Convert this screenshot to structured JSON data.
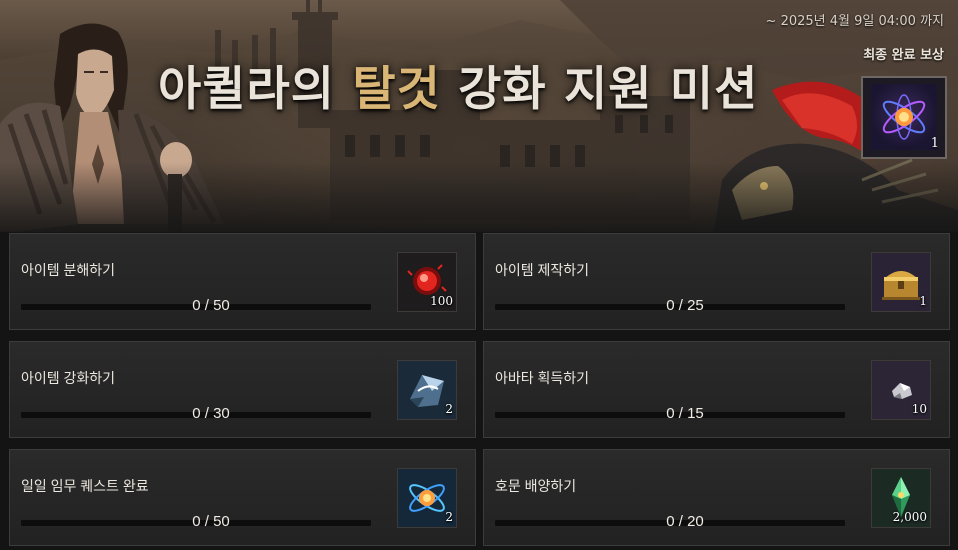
{
  "header": {
    "deadline": "~ 2025년 4월 9일 04:00 까지",
    "title_part1": "아퀼라의 ",
    "title_accent": "탈것",
    "title_part2": " 강화 지원 미션",
    "final_reward_label": "최종 완료 보상",
    "final_reward_count": "1",
    "final_reward_icon": "purple-orb-icon"
  },
  "missions": [
    {
      "name": "아이템 분해하기",
      "progress": "0 / 50",
      "fraction": 0,
      "reward_count": "100",
      "reward_icon": "red-orb-icon"
    },
    {
      "name": "아이템 제작하기",
      "progress": "0 / 25",
      "fraction": 0,
      "reward_count": "1",
      "reward_icon": "gold-chest-icon"
    },
    {
      "name": "아이템 강화하기",
      "progress": "0 / 30",
      "fraction": 0,
      "reward_count": "2",
      "reward_icon": "blue-stone-icon"
    },
    {
      "name": "아바타 획득하기",
      "progress": "0 / 15",
      "fraction": 0,
      "reward_count": "10",
      "reward_icon": "silver-ore-icon"
    },
    {
      "name": "일일 임무 퀘스트 완료",
      "progress": "0 / 50",
      "fraction": 0,
      "reward_count": "2",
      "reward_icon": "blue-orb-icon"
    },
    {
      "name": "호문 배양하기",
      "progress": "0 / 20",
      "fraction": 0,
      "reward_count": "2,000",
      "reward_icon": "green-crystal-icon"
    }
  ],
  "colors": {
    "accent": "#d9b676",
    "progress_fill": "#c89a4b",
    "card_bg": "#262626"
  }
}
